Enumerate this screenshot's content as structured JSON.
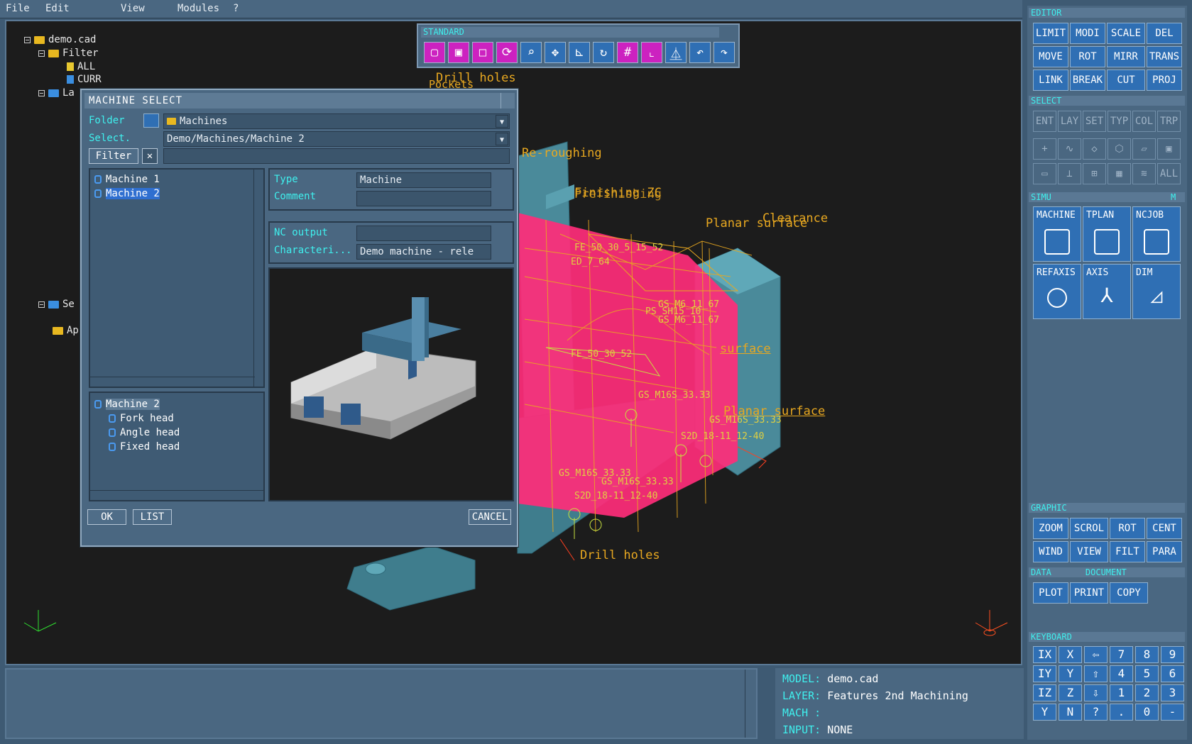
{
  "menubar": {
    "items": [
      "File",
      "Edit",
      "View",
      "Modules",
      "?"
    ]
  },
  "tree": {
    "root": "demo.cad",
    "filter": "Filter",
    "all": "ALL",
    "curr": "CURR",
    "layers_partial": "La",
    "sets_partial": "Se",
    "ap_partial": "Ap"
  },
  "standard_toolbar": {
    "title": "STANDARD",
    "icons": [
      "box-wire-icon",
      "box-shaded-icon",
      "box-hidden-icon",
      "refresh-icon",
      "zoom-icon",
      "pan-icon",
      "axis-icon",
      "rotate-icon",
      "grid-icon",
      "frame-icon",
      "plane-icon",
      "undo-icon",
      "redo-icon"
    ]
  },
  "scene_labels": {
    "drill_top": "Drill holes",
    "pockets": "Pockets",
    "reroughing": "Re-roughing",
    "finishing": "Finishing ZC",
    "prefinishing": "Prefinishing",
    "planar": "Planar surface",
    "clearance": "Clearance",
    "surface": "surface",
    "planar_bottom": "Planar surface",
    "drill_bottom": "Drill holes",
    "tools": [
      "FE_50_30_5_15_52",
      "ED_7_64",
      "GS_M6_11_67",
      "PS_SH15_10",
      "GS_M6_11_67",
      "FE_50_30_52",
      "GS_M16S_33.33",
      "GS_M16S_33.33",
      "S2D_18-11_12-40",
      "GS_M16S_33.33",
      "GS_M16S_33.33",
      "S2D_18-11_12-40"
    ]
  },
  "dialog": {
    "title": "MACHINE SELECT",
    "folder_label": "Folder",
    "folder_value": "Machines",
    "select_label": "Select.",
    "select_value": "Demo/Machines/Machine 2",
    "filter_button": "Filter",
    "filter_value": "",
    "machines": [
      "Machine 1",
      "Machine 2"
    ],
    "selected_machine": "Machine 2",
    "heads_root": "Machine 2",
    "heads": [
      "Fork head",
      "Angle head",
      "Fixed head"
    ],
    "type_label": "Type",
    "type_value": "Machine",
    "comment_label": "Comment",
    "comment_value": "",
    "nc_label": "NC output",
    "nc_value": "",
    "char_label": "Characteri...",
    "char_value": "Demo machine - rele",
    "ok": "OK",
    "list": "LIST",
    "cancel": "CANCEL"
  },
  "right_panel": {
    "editor_title": "EDITOR",
    "editor_buttons": [
      "LIMIT",
      "MODI",
      "SCALE",
      "DEL",
      "MOVE",
      "ROT",
      "MIRR",
      "TRANS",
      "LINK",
      "BREAK",
      "CUT",
      "PROJ"
    ],
    "select_title": "SELECT",
    "select_buttons": [
      "ENT",
      "LAY",
      "SET",
      "TYP",
      "COL",
      "TRP"
    ],
    "shape_icons": [
      "plus-icon",
      "curve-icon",
      "surface-icon",
      "solid-icon",
      "plane-icon",
      "box-icon",
      "sheet-icon",
      "triad-icon",
      "point-grid-icon",
      "mesh-icon",
      "lines-icon"
    ],
    "shape_all": "ALL",
    "simu_title": "SIMU",
    "simu_m": "M",
    "simu_buttons": [
      "MACHINE",
      "TPLAN",
      "NCJOB",
      "REFAXIS",
      "AXIS",
      "DIM"
    ],
    "graphic_title": "GRAPHIC",
    "graphic_buttons": [
      "ZOOM",
      "SCROL",
      "ROT",
      "CENT",
      "WIND",
      "VIEW",
      "FILT",
      "PARA"
    ],
    "data_title": "DATA",
    "document_title": "DOCUMENT",
    "data_buttons": [
      "PLOT",
      "PRINT",
      "COPY"
    ],
    "keyboard_title": "KEYBOARD",
    "keys": [
      "IX",
      "X",
      "⇦",
      "7",
      "8",
      "9",
      "IY",
      "Y",
      "⇧",
      "4",
      "5",
      "6",
      "IZ",
      "Z",
      "⇩",
      "1",
      "2",
      "3",
      "Y",
      "N",
      "?",
      "",
      "0",
      "-"
    ]
  },
  "info": {
    "model_label": "MODEL:",
    "model_value": "demo.cad",
    "layer_label": "LAYER:",
    "layer_value": "Features 2nd Machining",
    "mach_label": "MACH :",
    "mach_value": "",
    "input_label": "INPUT:",
    "input_value": "NONE"
  },
  "colors": {
    "accent": "#3ff0ee",
    "panel": "#4a6781",
    "magenta": "#cc22c0",
    "toolpath": "#ff2d7a"
  }
}
